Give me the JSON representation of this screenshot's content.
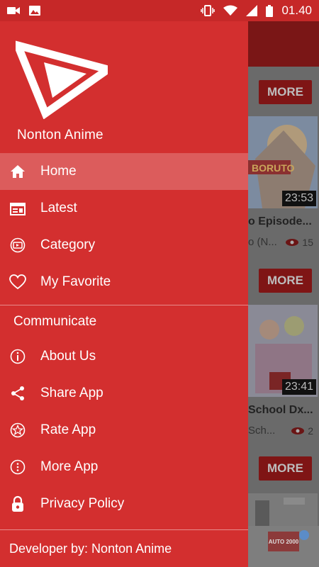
{
  "status_bar": {
    "time": "01.40",
    "left_icons": [
      "video-camera-icon",
      "image-icon"
    ],
    "right_icons": [
      "vibrate-icon",
      "wifi-icon",
      "signal-icon",
      "battery-icon"
    ]
  },
  "drawer": {
    "app_name": "Nonton Anime",
    "menu": [
      {
        "label": "Home",
        "icon": "home-icon",
        "active": true
      },
      {
        "label": "Latest",
        "icon": "calendar-icon",
        "active": false
      },
      {
        "label": "Category",
        "icon": "video-category-icon",
        "active": false
      },
      {
        "label": "My Favorite",
        "icon": "heart-icon",
        "active": false
      }
    ],
    "section_label": "Communicate",
    "communicate": [
      {
        "label": "About Us",
        "icon": "info-icon"
      },
      {
        "label": "Share App",
        "icon": "share-icon"
      },
      {
        "label": "Rate App",
        "icon": "star-icon"
      },
      {
        "label": "More App",
        "icon": "more-icon"
      },
      {
        "label": "Privacy Policy",
        "icon": "lock-icon"
      }
    ],
    "footer": "Developer by: Nonton Anime"
  },
  "background": {
    "more_label": "MORE",
    "cards": [
      {
        "duration": "23:53",
        "title": "o Episode...",
        "sub": "o (N...",
        "views": "15"
      },
      {
        "duration": "23:41",
        "title": "School Dx...",
        "sub": "Sch...",
        "views": "2"
      }
    ],
    "ad_text": "AUTO 2000"
  },
  "colors": {
    "primary": "#d32f2f",
    "status_bar": "#c62828"
  }
}
